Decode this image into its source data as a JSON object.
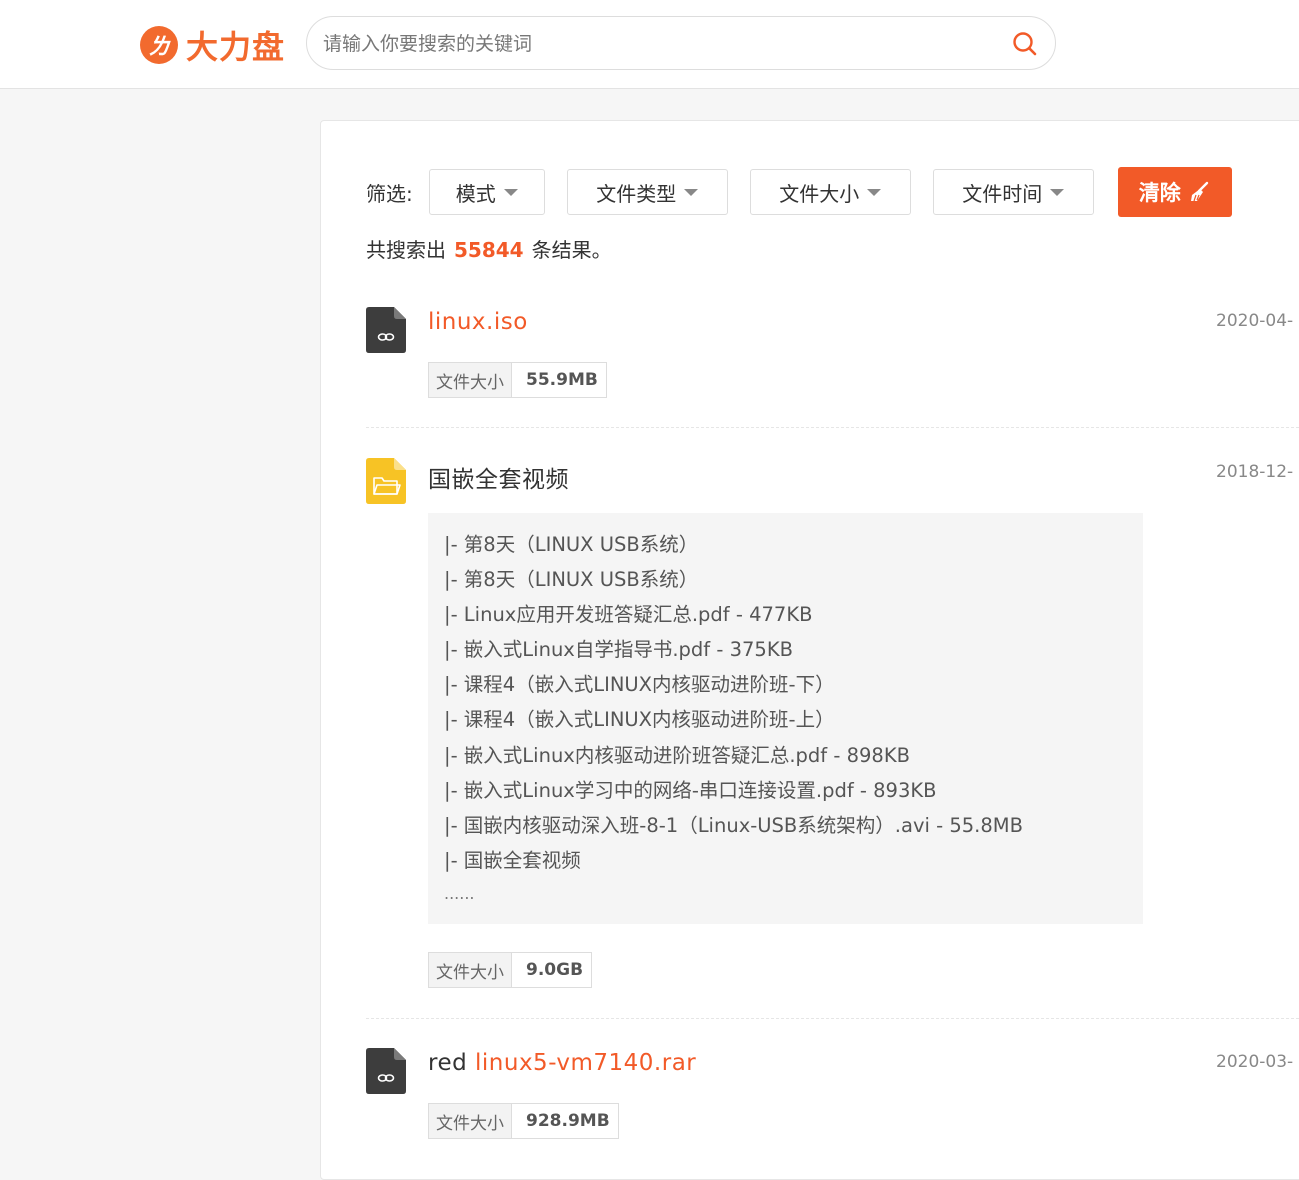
{
  "logo": {
    "text": "大力盘"
  },
  "search": {
    "placeholder": "请输入你要搜索的关键词"
  },
  "filters": {
    "label": "筛选:",
    "items": [
      "模式",
      "文件类型",
      "文件大小",
      "文件时间"
    ],
    "clear_label": "清除"
  },
  "summary": {
    "prefix": "共搜索出",
    "count": "55844",
    "suffix": "条结果。"
  },
  "results": [
    {
      "icon": "link-file-icon",
      "title_plain": "",
      "title_highlight": "linux.iso",
      "date": "2020-04-",
      "size_label": "文件大小",
      "size": "55.9MB"
    },
    {
      "icon": "folder-icon",
      "title_plain": "国嵌全套视频",
      "title_highlight": "",
      "date": "2018-12-",
      "files": [
        "|- 第8天（LINUX USB系统）",
        "|- 第8天（LINUX USB系统）",
        "|- Linux应用开发班答疑汇总.pdf - 477KB",
        "|- 嵌入式Linux自学指导书.pdf - 375KB",
        "|- 课程4（嵌入式LINUX内核驱动进阶班-下）",
        "|- 课程4（嵌入式LINUX内核驱动进阶班-上）",
        "|- 嵌入式Linux内核驱动进阶班答疑汇总.pdf - 898KB",
        "|- 嵌入式Linux学习中的网络-串口连接设置.pdf - 893KB",
        "|- 国嵌内核驱动深入班-8-1（Linux-USB系统架构）.avi - 55.8MB",
        "|- 国嵌全套视频"
      ],
      "more": "......",
      "size_label": "文件大小",
      "size": "9.0GB"
    },
    {
      "icon": "link-file-icon",
      "title_plain": "red ",
      "title_highlight": "linux5-vm7140.rar",
      "date": "2020-03-",
      "size_label": "文件大小",
      "size": "928.9MB"
    }
  ]
}
